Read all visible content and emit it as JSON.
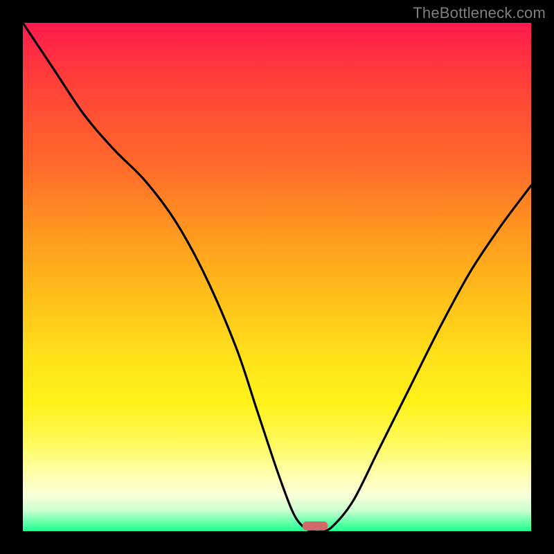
{
  "watermark": "TheBottleneck.com",
  "chart_data": {
    "type": "line",
    "title": "",
    "xlabel": "",
    "ylabel": "",
    "xlim": [
      0,
      100
    ],
    "ylim": [
      0,
      100
    ],
    "series": [
      {
        "name": "bottleneck-curve",
        "x": [
          0,
          6,
          12,
          18,
          24,
          30,
          36,
          42,
          46,
          50,
          53,
          55,
          57,
          59,
          61,
          65,
          70,
          76,
          82,
          88,
          94,
          100
        ],
        "values": [
          100,
          91,
          82,
          75,
          69,
          61,
          50,
          36,
          24,
          12,
          4,
          1,
          0,
          0,
          1,
          6,
          16,
          28,
          40,
          51,
          60,
          68
        ]
      }
    ],
    "marker": {
      "name": "optimal-range",
      "x_start": 55,
      "x_end": 60,
      "color": "#d16a6a"
    },
    "gradient_stops": [
      {
        "pos": 0,
        "color": "#ff1a4d"
      },
      {
        "pos": 50,
        "color": "#ffe21a"
      },
      {
        "pos": 100,
        "color": "#1fff8f"
      }
    ]
  }
}
